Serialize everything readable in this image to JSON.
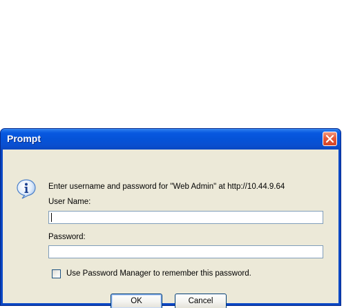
{
  "dialog": {
    "title": "Prompt",
    "message": "Enter username and password for \"Web Admin\" at http://10.44.9.64",
    "username_label": "User Name:",
    "username_value": "",
    "password_label": "Password:",
    "password_value": "",
    "remember_label": "Use Password Manager to remember this password.",
    "remember_checked": false,
    "ok_label": "OK",
    "cancel_label": "Cancel"
  },
  "icons": {
    "info": "info-icon",
    "close": "close-icon"
  },
  "colors": {
    "titlebar": "#0553d8",
    "close_button": "#e5593a",
    "client_background": "#ece9d8",
    "input_border": "#7f9db9"
  }
}
